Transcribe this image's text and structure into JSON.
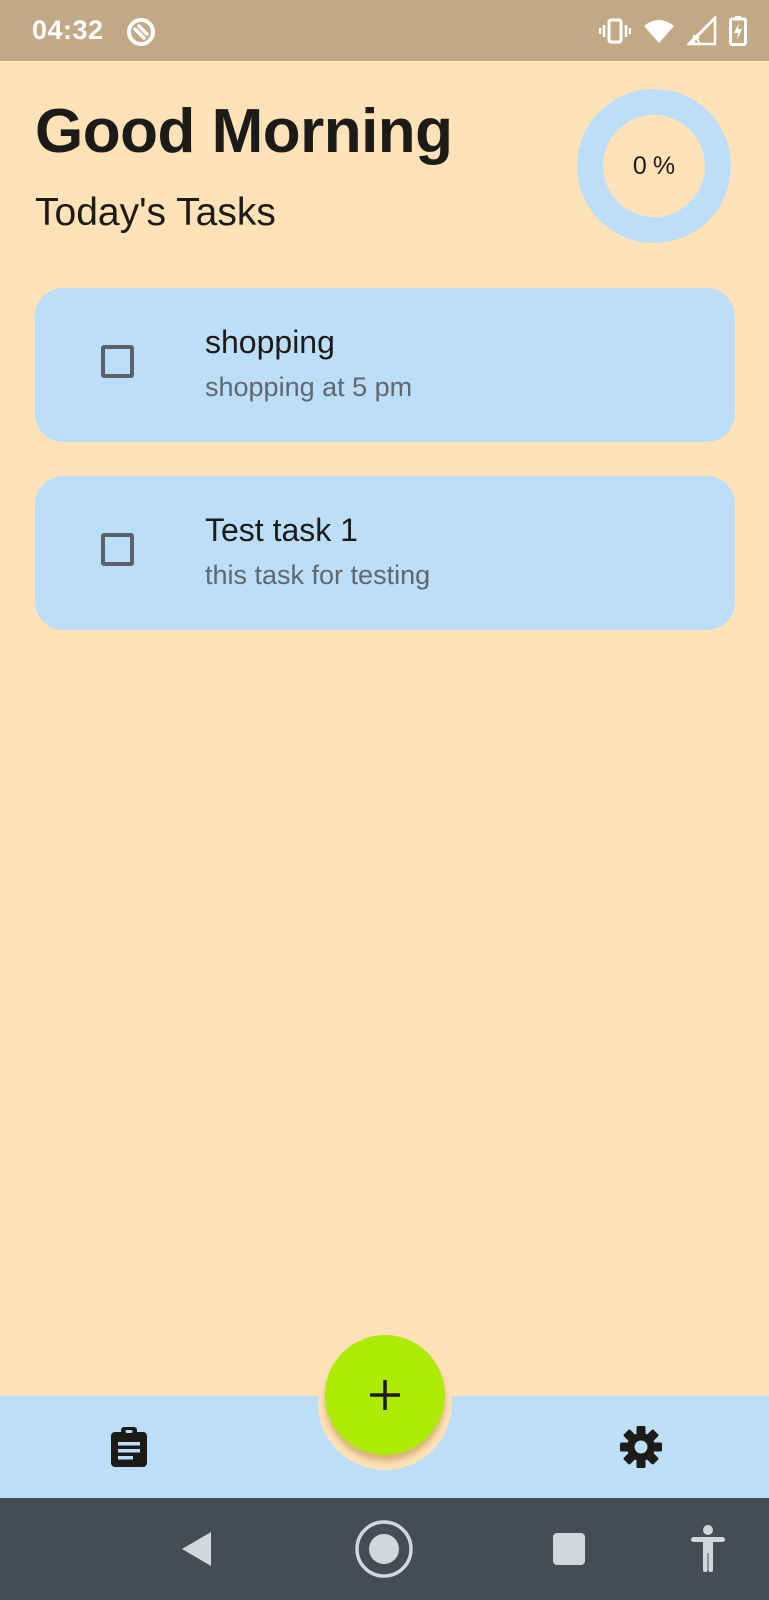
{
  "status_bar": {
    "time": "04:32",
    "icons": [
      "app-notification-icon",
      "vibrate-icon",
      "wifi-icon",
      "signal-roaming-icon",
      "battery-charging-icon"
    ]
  },
  "header": {
    "greeting": "Good Morning",
    "subtitle": "Today's Tasks"
  },
  "progress": {
    "value": "0",
    "unit": "%",
    "fraction": 0
  },
  "tasks": [
    {
      "title": "shopping",
      "description": "shopping at 5 pm",
      "completed": false
    },
    {
      "title": "Test task 1",
      "description": "this task for testing",
      "completed": false
    }
  ],
  "bottom_bar": {
    "left_icon": "clipboard-tasks-icon",
    "right_icon": "settings-gear-icon",
    "fab_icon": "plus-icon"
  },
  "system_nav": {
    "icons": [
      "back-icon",
      "home-icon",
      "recents-icon",
      "accessibility-icon"
    ]
  },
  "colors": {
    "background": "#FFE2B7",
    "status_bar": "#C2A986",
    "card": "#BDDEF8",
    "fab": "#ADEB05",
    "system_nav": "#444C54"
  }
}
